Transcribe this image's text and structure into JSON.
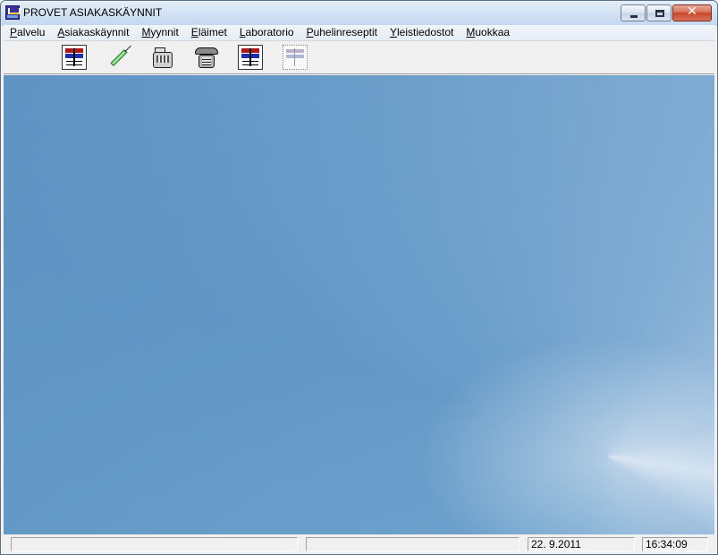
{
  "window": {
    "title": "PROVET ASIAKASKÄYNNIT",
    "minimize_icon": "minimize-icon",
    "maximize_icon": "maximize-icon",
    "close_glyph": "x"
  },
  "menu": {
    "items": [
      {
        "hotkey": "P",
        "rest": "alvelu"
      },
      {
        "hotkey": "A",
        "rest": "siakaskäynnit"
      },
      {
        "hotkey": "M",
        "rest": "yynnit"
      },
      {
        "hotkey": "E",
        "rest": "läimet"
      },
      {
        "hotkey": "L",
        "rest": "aboratorio"
      },
      {
        "hotkey": "P",
        "rest": "uhelinreseptit"
      },
      {
        "hotkey": "Y",
        "rest": "leistiedostot"
      },
      {
        "hotkey": "M",
        "rest": "uokkaa"
      }
    ]
  },
  "toolbar": {
    "icons": [
      "chart-icon",
      "syringe-icon",
      "cash-register-icon",
      "telephone-icon",
      "chart-icon",
      "chart-disabled-icon"
    ]
  },
  "statusbar": {
    "panel1": "",
    "panel2": "",
    "date": "22. 9.2011",
    "time": "16:34:09"
  },
  "colors": {
    "client_background": "#6a9fcb",
    "title_bar": "#d3e3f4",
    "close_button": "#c8442a"
  }
}
